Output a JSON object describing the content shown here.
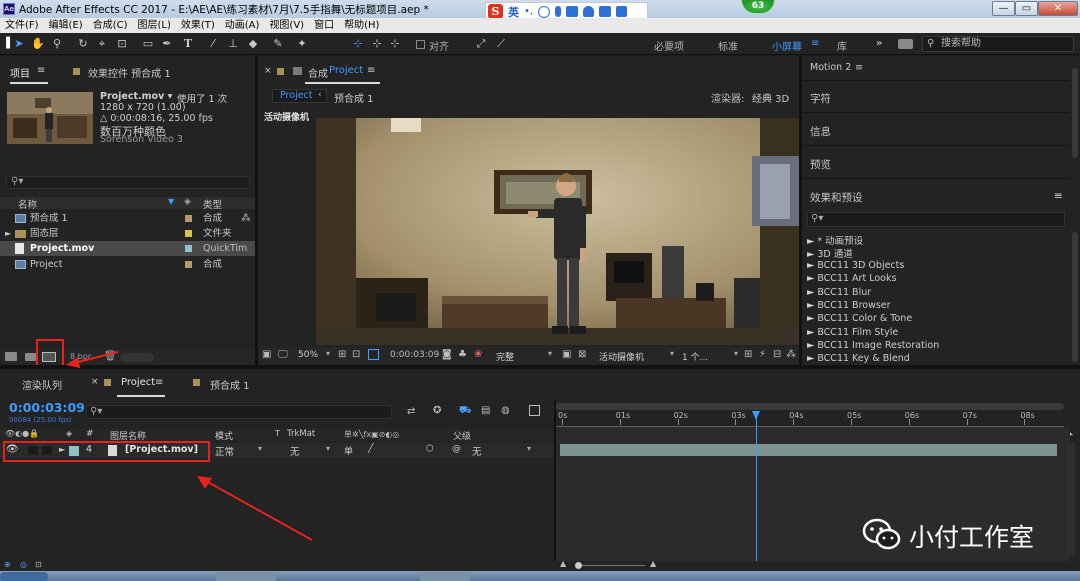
{
  "title_bar": {
    "app_icon": "Ae",
    "title": "Adobe After Effects CC 2017 - E:\\AE\\AE\\练习素材\\7月\\7.5手指舞\\无标题项目.aep *",
    "minimize": "—",
    "maximize": "▭",
    "close": "✕"
  },
  "ime_bar": {
    "logo": "S",
    "lang": "英"
  },
  "notify_badge": "63",
  "menu": [
    "文件(F)",
    "编辑(E)",
    "合成(C)",
    "图层(L)",
    "效果(T)",
    "动画(A)",
    "视图(V)",
    "窗口",
    "帮助(H)"
  ],
  "toolbar": {
    "align_label": "对齐",
    "workspaces": [
      "必要项",
      "标准",
      "小屏幕",
      "库"
    ],
    "active_workspace": "小屏幕",
    "search_help": "搜索帮助"
  },
  "project_panel": {
    "tabs": [
      "项目",
      "效果控件 预合成 1"
    ],
    "item": {
      "name": "Project.mov ▾",
      "used": "使用了 1 次",
      "size": "1280 x 720 (1.00)",
      "duration": "△ 0:00:08:16, 25.00 fps",
      "colors": "数百万种颜色",
      "codec": "Sorenson Video 3"
    },
    "columns": {
      "name": "名称",
      "type": "类型"
    },
    "rows": [
      {
        "name": "预合成 1",
        "type": "合成",
        "label_color": "#b59a6a"
      },
      {
        "name": "固态层",
        "type": "文件夹",
        "label_color": "#d6c64a"
      },
      {
        "name": "Project.mov",
        "type": "QuickTim",
        "label_color": "#8fc2c8"
      },
      {
        "name": "Project",
        "type": "合成",
        "label_color": "#b59a6a"
      }
    ],
    "bpc": "8 bpc"
  },
  "comp_panel": {
    "tab": "合成",
    "tab_name": "Project",
    "sub_tabs": [
      "Project",
      "预合成 1"
    ],
    "renderer_label": "渲染器:",
    "renderer_value": "经典 3D",
    "camera_label": "活动摄像机",
    "zoom": "50%",
    "timecode": "0:00:03:09",
    "quality": "完整",
    "view_camera": "活动摄像机",
    "view_count": "1 个..."
  },
  "effects_panel": {
    "headers": [
      "Motion 2",
      "字符",
      "信息",
      "预览",
      "效果和预设"
    ],
    "items": [
      "► * 动画预设",
      "► 3D 通道",
      "► BCC11 3D Objects",
      "► BCC11 Art Looks",
      "► BCC11 Blur",
      "► BCC11 Browser",
      "► BCC11 Color & Tone",
      "► BCC11 Film Style",
      "► BCC11 Image Restoration",
      "► BCC11 Key & Blend"
    ]
  },
  "timeline": {
    "tabs": [
      "渲染队列",
      "Project",
      "预合成 1"
    ],
    "timecode": "0:00:03:09",
    "frame_info": "00084 (25.00 fps)",
    "columns": [
      "#",
      "图层名称",
      "模式",
      "T",
      "TrkMat",
      "父级"
    ],
    "ruler": [
      "0s",
      "01s",
      "02s",
      "03s",
      "04s",
      "05s",
      "06s",
      "07s",
      "08s"
    ],
    "playhead_position": 3.36,
    "duration": 8.64,
    "layer": {
      "index": "4",
      "name": "[Project.mov]",
      "mode": "正常",
      "trkmat": "无",
      "parent": "无"
    }
  },
  "watermark": "小付工作室",
  "annotation_color": "#e4221e"
}
